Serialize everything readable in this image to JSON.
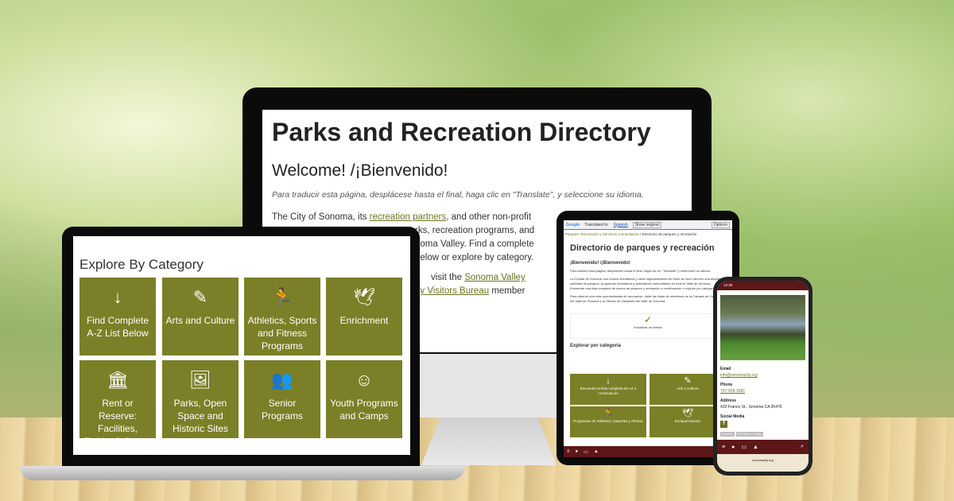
{
  "monitor": {
    "title": "Parks and Recreation Directory",
    "welcome": "Welcome! /¡Bienvenido!",
    "translate_note": "Para traducir esta página, desplácese hasta el final, haga clic en \"Translate\", y seleccione su idioma.",
    "p1_line1_a": "The City of Sonoma, its",
    "p1_link": "recreation partners",
    "p1_line1_b": ", and other non-profit",
    "p1_line2": "rks, recreation programs, and",
    "p1_line3": "noma Valley. Find a complete",
    "p1_line4": "below or explore by category.",
    "p2_line1": "visit the",
    "p2_link1": "Sonoma Valley",
    "p2_link2": "ey Visitors Bureau",
    "p2_line2": "member"
  },
  "laptop": {
    "heading": "Explore By Category",
    "tiles": [
      {
        "icon": "arrow-down",
        "label": "Find Complete A-Z List Below"
      },
      {
        "icon": "paintbrush",
        "label": "Arts and Culture"
      },
      {
        "icon": "running",
        "label": "Athletics, Sports and Fitness Programs"
      },
      {
        "icon": "dove",
        "label": "Enrichment"
      },
      {
        "icon": "landmark",
        "label": "Rent or Reserve: Facilities, Fields, & Courts"
      },
      {
        "icon": "image",
        "label": "Parks, Open Space and Historic Sites"
      },
      {
        "icon": "users",
        "label": "Senior Programs"
      },
      {
        "icon": "child",
        "label": "Youth Programs and Camps"
      }
    ]
  },
  "tablet": {
    "google": "Google",
    "translated_to": "Translated to:",
    "language": "Spanish",
    "show_original": "Show original",
    "options": "Options",
    "breadcrumb": [
      "Parques, Recreación y Servicios Comunitarios",
      "Directorio de parques y recreación"
    ],
    "title": "Directorio de parques y recreación",
    "welcome": "¡Bienvenido! /¡Bienvenido!",
    "note": "Para traducir esta página, desplácese hasta el final, haga clic en \"Translate\" y seleccione su idioma.",
    "p1": "La Ciudad de Sonoma, sus socios recreativos y otras organizaciones sin fines de lucro ofrecen una amplia variedad de parques, programas recreativos y actividades comunitarias en todo el Valle de Sonoma. Encuentre una lista completa de socios de parques y recreación a continuación o explore por categoría.",
    "p2": "Para obtener aún más oportunidades de recreación, visite las listas de miembros de la Cámara de Comercio del Valle de Sonoma y la Oficina de Visitantes del Valle de Sonoma.",
    "update_label": "Actualizar un listado",
    "explore": "Explorar por categoría",
    "tiles": [
      {
        "icon": "arrow-down",
        "label": "Encuentre la lista completa de AZ a continuación"
      },
      {
        "icon": "paintbrush",
        "label": "Arte y Cultura"
      },
      {
        "icon": "running",
        "label": "Programas de Atletismo, Deportes y Fitness"
      },
      {
        "icon": "dove",
        "label": "Enriquecimiento"
      }
    ]
  },
  "phone": {
    "time": "12:30",
    "email_label": "Email",
    "email": "info@sonomacity.org",
    "phone_label": "Phone",
    "phone": "707-938-3681",
    "address_label": "Address",
    "address": "433 France St., Sonoma CA 95476",
    "social_label": "Social Media",
    "tags": [
      "Beaches",
      "City Park or Facility"
    ],
    "url": "sonomacity.org"
  },
  "colors": {
    "olive": "#7b7f27",
    "maroon": "#5e1719"
  }
}
